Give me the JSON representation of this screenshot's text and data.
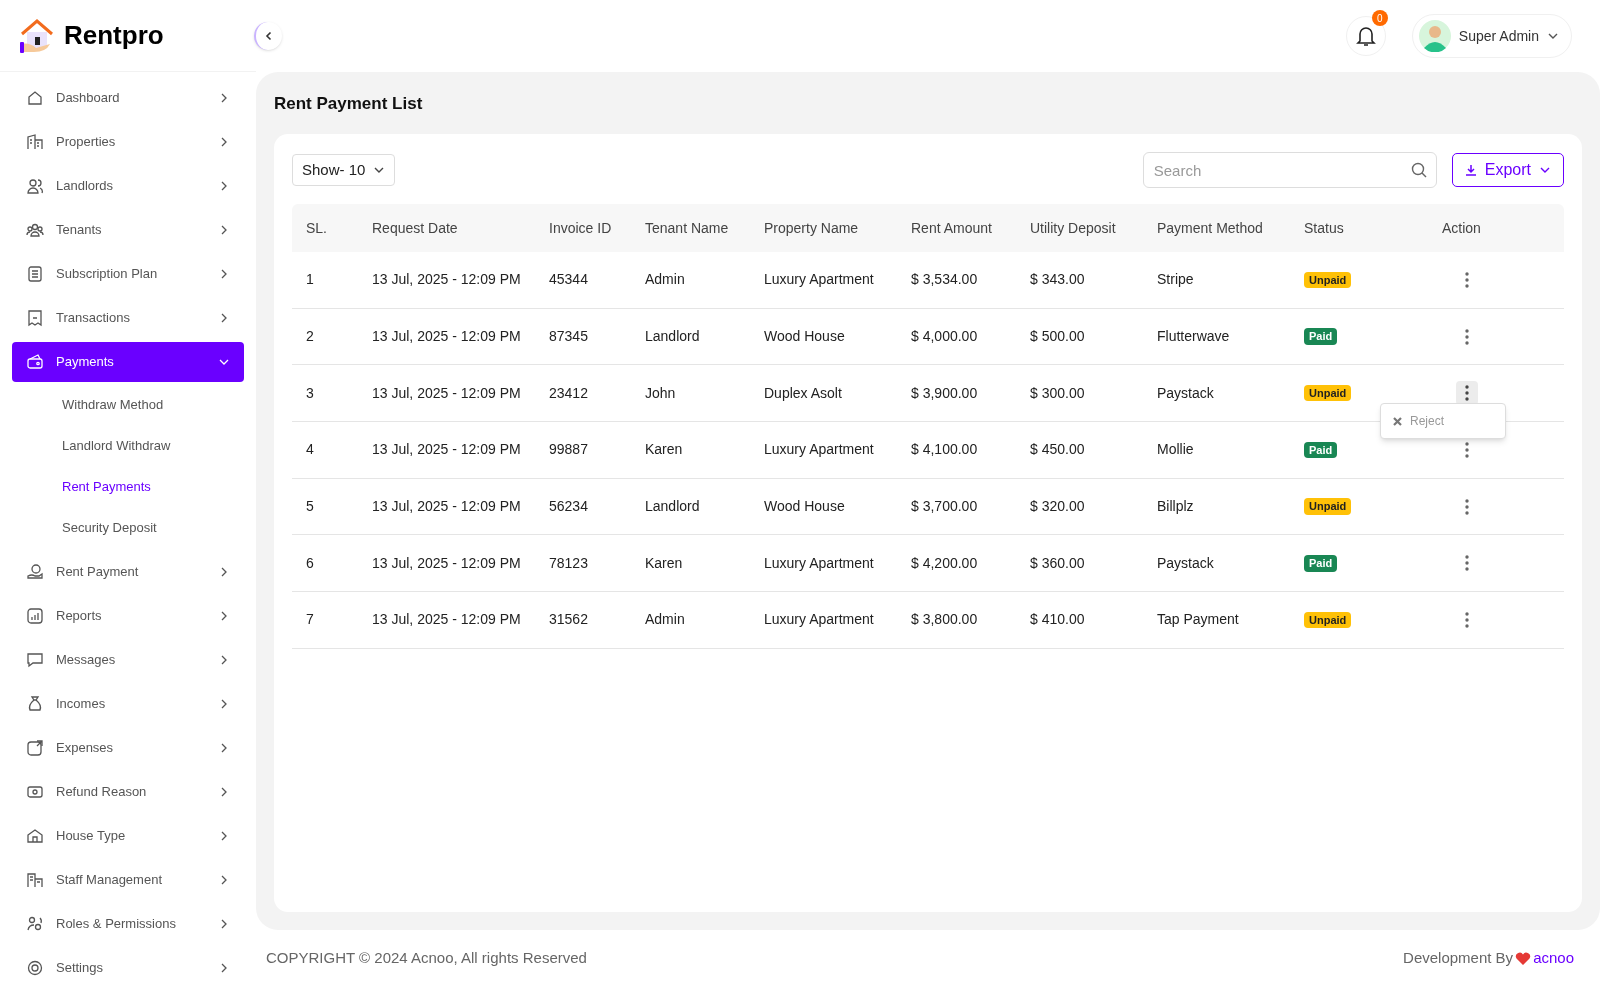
{
  "brand": {
    "name": "Rentpro"
  },
  "sidebar": {
    "items": [
      {
        "label": "Dashboard",
        "selected": false,
        "expanded": false
      },
      {
        "label": "Properties",
        "selected": false,
        "expanded": false
      },
      {
        "label": "Landlords",
        "selected": false,
        "expanded": false
      },
      {
        "label": "Tenants",
        "selected": false,
        "expanded": false
      },
      {
        "label": "Subscription Plan",
        "selected": false,
        "expanded": false
      },
      {
        "label": "Transactions",
        "selected": false,
        "expanded": false
      },
      {
        "label": "Payments",
        "selected": true,
        "expanded": true,
        "children": [
          {
            "label": "Withdraw Method",
            "selected": false
          },
          {
            "label": "Landlord Withdraw",
            "selected": false
          },
          {
            "label": "Rent Payments",
            "selected": true
          },
          {
            "label": "Security Deposit",
            "selected": false
          }
        ]
      },
      {
        "label": "Rent Payment",
        "selected": false,
        "expanded": false
      },
      {
        "label": "Reports",
        "selected": false,
        "expanded": false
      },
      {
        "label": "Messages",
        "selected": false,
        "expanded": false
      },
      {
        "label": "Incomes",
        "selected": false,
        "expanded": false
      },
      {
        "label": "Expenses",
        "selected": false,
        "expanded": false
      },
      {
        "label": "Refund Reason",
        "selected": false,
        "expanded": false
      },
      {
        "label": "House Type",
        "selected": false,
        "expanded": false
      },
      {
        "label": "Staff Management",
        "selected": false,
        "expanded": false
      },
      {
        "label": "Roles & Permissions",
        "selected": false,
        "expanded": false
      },
      {
        "label": "Settings",
        "selected": false,
        "expanded": false
      }
    ]
  },
  "header": {
    "notification_count": "0",
    "user": "Super Admin"
  },
  "page_title": "Rent Payment List",
  "toolbar": {
    "show": "Show- 10",
    "search_placeholder": "Search",
    "export": "Export"
  },
  "table": {
    "columns": [
      "SL.",
      "Request Date",
      "Invoice ID",
      "Tenant Name",
      "Property Name",
      "Rent Amount",
      "Utility Deposit",
      "Payment Method",
      "Status",
      "Action"
    ],
    "rows": [
      {
        "sl": "1",
        "date": "13 Jul, 2025 - 12:09 PM",
        "invoice": "45344",
        "tenant": "Admin",
        "property": "Luxury Apartment",
        "rent": "$ 3,534.00",
        "utility": "$ 343.00",
        "method": "Stripe",
        "status": "Unpaid",
        "paid": false,
        "menu_open": false
      },
      {
        "sl": "2",
        "date": "13 Jul, 2025 - 12:09 PM",
        "invoice": "87345",
        "tenant": "Landlord",
        "property": "Wood House",
        "rent": "$ 4,000.00",
        "utility": "$ 500.00",
        "method": "Flutterwave",
        "status": "Paid",
        "paid": true,
        "menu_open": false
      },
      {
        "sl": "3",
        "date": "13 Jul, 2025 - 12:09 PM",
        "invoice": "23412",
        "tenant": "John",
        "property": "Duplex Asolt",
        "rent": "$ 3,900.00",
        "utility": "$ 300.00",
        "method": "Paystack",
        "status": "Unpaid",
        "paid": false,
        "menu_open": true
      },
      {
        "sl": "4",
        "date": "13 Jul, 2025 - 12:09 PM",
        "invoice": "99887",
        "tenant": "Karen",
        "property": "Luxury Apartment",
        "rent": "$ 4,100.00",
        "utility": "$ 450.00",
        "method": "Mollie",
        "status": "Paid",
        "paid": true,
        "menu_open": false
      },
      {
        "sl": "5",
        "date": "13 Jul, 2025 - 12:09 PM",
        "invoice": "56234",
        "tenant": "Landlord",
        "property": "Wood House",
        "rent": "$ 3,700.00",
        "utility": "$ 320.00",
        "method": "Billplz",
        "status": "Unpaid",
        "paid": false,
        "menu_open": false
      },
      {
        "sl": "6",
        "date": "13 Jul, 2025 - 12:09 PM",
        "invoice": "78123",
        "tenant": "Karen",
        "property": "Luxury Apartment",
        "rent": "$ 4,200.00",
        "utility": "$ 360.00",
        "method": "Paystack",
        "status": "Paid",
        "paid": true,
        "menu_open": false
      },
      {
        "sl": "7",
        "date": "13 Jul, 2025 - 12:09 PM",
        "invoice": "31562",
        "tenant": "Admin",
        "property": "Luxury Apartment",
        "rent": "$ 3,800.00",
        "utility": "$ 410.00",
        "method": "Tap Payment",
        "status": "Unpaid",
        "paid": false,
        "menu_open": false
      }
    ]
  },
  "action_menu": {
    "items": [
      "Reject"
    ]
  },
  "footer": {
    "copyright": "COPYRIGHT © 2024 Acnoo, All rights Reserved",
    "credit": "Development By",
    "credit_link": "acnoo"
  }
}
